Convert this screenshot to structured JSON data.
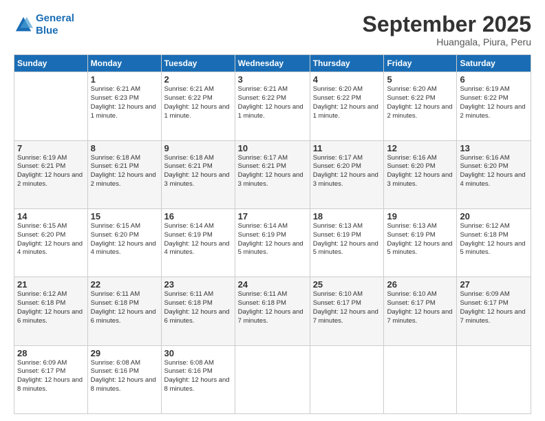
{
  "header": {
    "logo_line1": "General",
    "logo_line2": "Blue",
    "month_title": "September 2025",
    "location": "Huangala, Piura, Peru"
  },
  "days_of_week": [
    "Sunday",
    "Monday",
    "Tuesday",
    "Wednesday",
    "Thursday",
    "Friday",
    "Saturday"
  ],
  "weeks": [
    [
      {
        "day": "",
        "info": ""
      },
      {
        "day": "1",
        "info": "Sunrise: 6:21 AM\nSunset: 6:23 PM\nDaylight: 12 hours\nand 1 minute."
      },
      {
        "day": "2",
        "info": "Sunrise: 6:21 AM\nSunset: 6:22 PM\nDaylight: 12 hours\nand 1 minute."
      },
      {
        "day": "3",
        "info": "Sunrise: 6:21 AM\nSunset: 6:22 PM\nDaylight: 12 hours\nand 1 minute."
      },
      {
        "day": "4",
        "info": "Sunrise: 6:20 AM\nSunset: 6:22 PM\nDaylight: 12 hours\nand 1 minute."
      },
      {
        "day": "5",
        "info": "Sunrise: 6:20 AM\nSunset: 6:22 PM\nDaylight: 12 hours\nand 2 minutes."
      },
      {
        "day": "6",
        "info": "Sunrise: 6:19 AM\nSunset: 6:22 PM\nDaylight: 12 hours\nand 2 minutes."
      }
    ],
    [
      {
        "day": "7",
        "info": "Sunrise: 6:19 AM\nSunset: 6:21 PM\nDaylight: 12 hours\nand 2 minutes."
      },
      {
        "day": "8",
        "info": "Sunrise: 6:18 AM\nSunset: 6:21 PM\nDaylight: 12 hours\nand 2 minutes."
      },
      {
        "day": "9",
        "info": "Sunrise: 6:18 AM\nSunset: 6:21 PM\nDaylight: 12 hours\nand 3 minutes."
      },
      {
        "day": "10",
        "info": "Sunrise: 6:17 AM\nSunset: 6:21 PM\nDaylight: 12 hours\nand 3 minutes."
      },
      {
        "day": "11",
        "info": "Sunrise: 6:17 AM\nSunset: 6:20 PM\nDaylight: 12 hours\nand 3 minutes."
      },
      {
        "day": "12",
        "info": "Sunrise: 6:16 AM\nSunset: 6:20 PM\nDaylight: 12 hours\nand 3 minutes."
      },
      {
        "day": "13",
        "info": "Sunrise: 6:16 AM\nSunset: 6:20 PM\nDaylight: 12 hours\nand 4 minutes."
      }
    ],
    [
      {
        "day": "14",
        "info": "Sunrise: 6:15 AM\nSunset: 6:20 PM\nDaylight: 12 hours\nand 4 minutes."
      },
      {
        "day": "15",
        "info": "Sunrise: 6:15 AM\nSunset: 6:20 PM\nDaylight: 12 hours\nand 4 minutes."
      },
      {
        "day": "16",
        "info": "Sunrise: 6:14 AM\nSunset: 6:19 PM\nDaylight: 12 hours\nand 4 minutes."
      },
      {
        "day": "17",
        "info": "Sunrise: 6:14 AM\nSunset: 6:19 PM\nDaylight: 12 hours\nand 5 minutes."
      },
      {
        "day": "18",
        "info": "Sunrise: 6:13 AM\nSunset: 6:19 PM\nDaylight: 12 hours\nand 5 minutes."
      },
      {
        "day": "19",
        "info": "Sunrise: 6:13 AM\nSunset: 6:19 PM\nDaylight: 12 hours\nand 5 minutes."
      },
      {
        "day": "20",
        "info": "Sunrise: 6:12 AM\nSunset: 6:18 PM\nDaylight: 12 hours\nand 5 minutes."
      }
    ],
    [
      {
        "day": "21",
        "info": "Sunrise: 6:12 AM\nSunset: 6:18 PM\nDaylight: 12 hours\nand 6 minutes."
      },
      {
        "day": "22",
        "info": "Sunrise: 6:11 AM\nSunset: 6:18 PM\nDaylight: 12 hours\nand 6 minutes."
      },
      {
        "day": "23",
        "info": "Sunrise: 6:11 AM\nSunset: 6:18 PM\nDaylight: 12 hours\nand 6 minutes."
      },
      {
        "day": "24",
        "info": "Sunrise: 6:11 AM\nSunset: 6:18 PM\nDaylight: 12 hours\nand 7 minutes."
      },
      {
        "day": "25",
        "info": "Sunrise: 6:10 AM\nSunset: 6:17 PM\nDaylight: 12 hours\nand 7 minutes."
      },
      {
        "day": "26",
        "info": "Sunrise: 6:10 AM\nSunset: 6:17 PM\nDaylight: 12 hours\nand 7 minutes."
      },
      {
        "day": "27",
        "info": "Sunrise: 6:09 AM\nSunset: 6:17 PM\nDaylight: 12 hours\nand 7 minutes."
      }
    ],
    [
      {
        "day": "28",
        "info": "Sunrise: 6:09 AM\nSunset: 6:17 PM\nDaylight: 12 hours\nand 8 minutes."
      },
      {
        "day": "29",
        "info": "Sunrise: 6:08 AM\nSunset: 6:16 PM\nDaylight: 12 hours\nand 8 minutes."
      },
      {
        "day": "30",
        "info": "Sunrise: 6:08 AM\nSunset: 6:16 PM\nDaylight: 12 hours\nand 8 minutes."
      },
      {
        "day": "",
        "info": ""
      },
      {
        "day": "",
        "info": ""
      },
      {
        "day": "",
        "info": ""
      },
      {
        "day": "",
        "info": ""
      }
    ]
  ]
}
